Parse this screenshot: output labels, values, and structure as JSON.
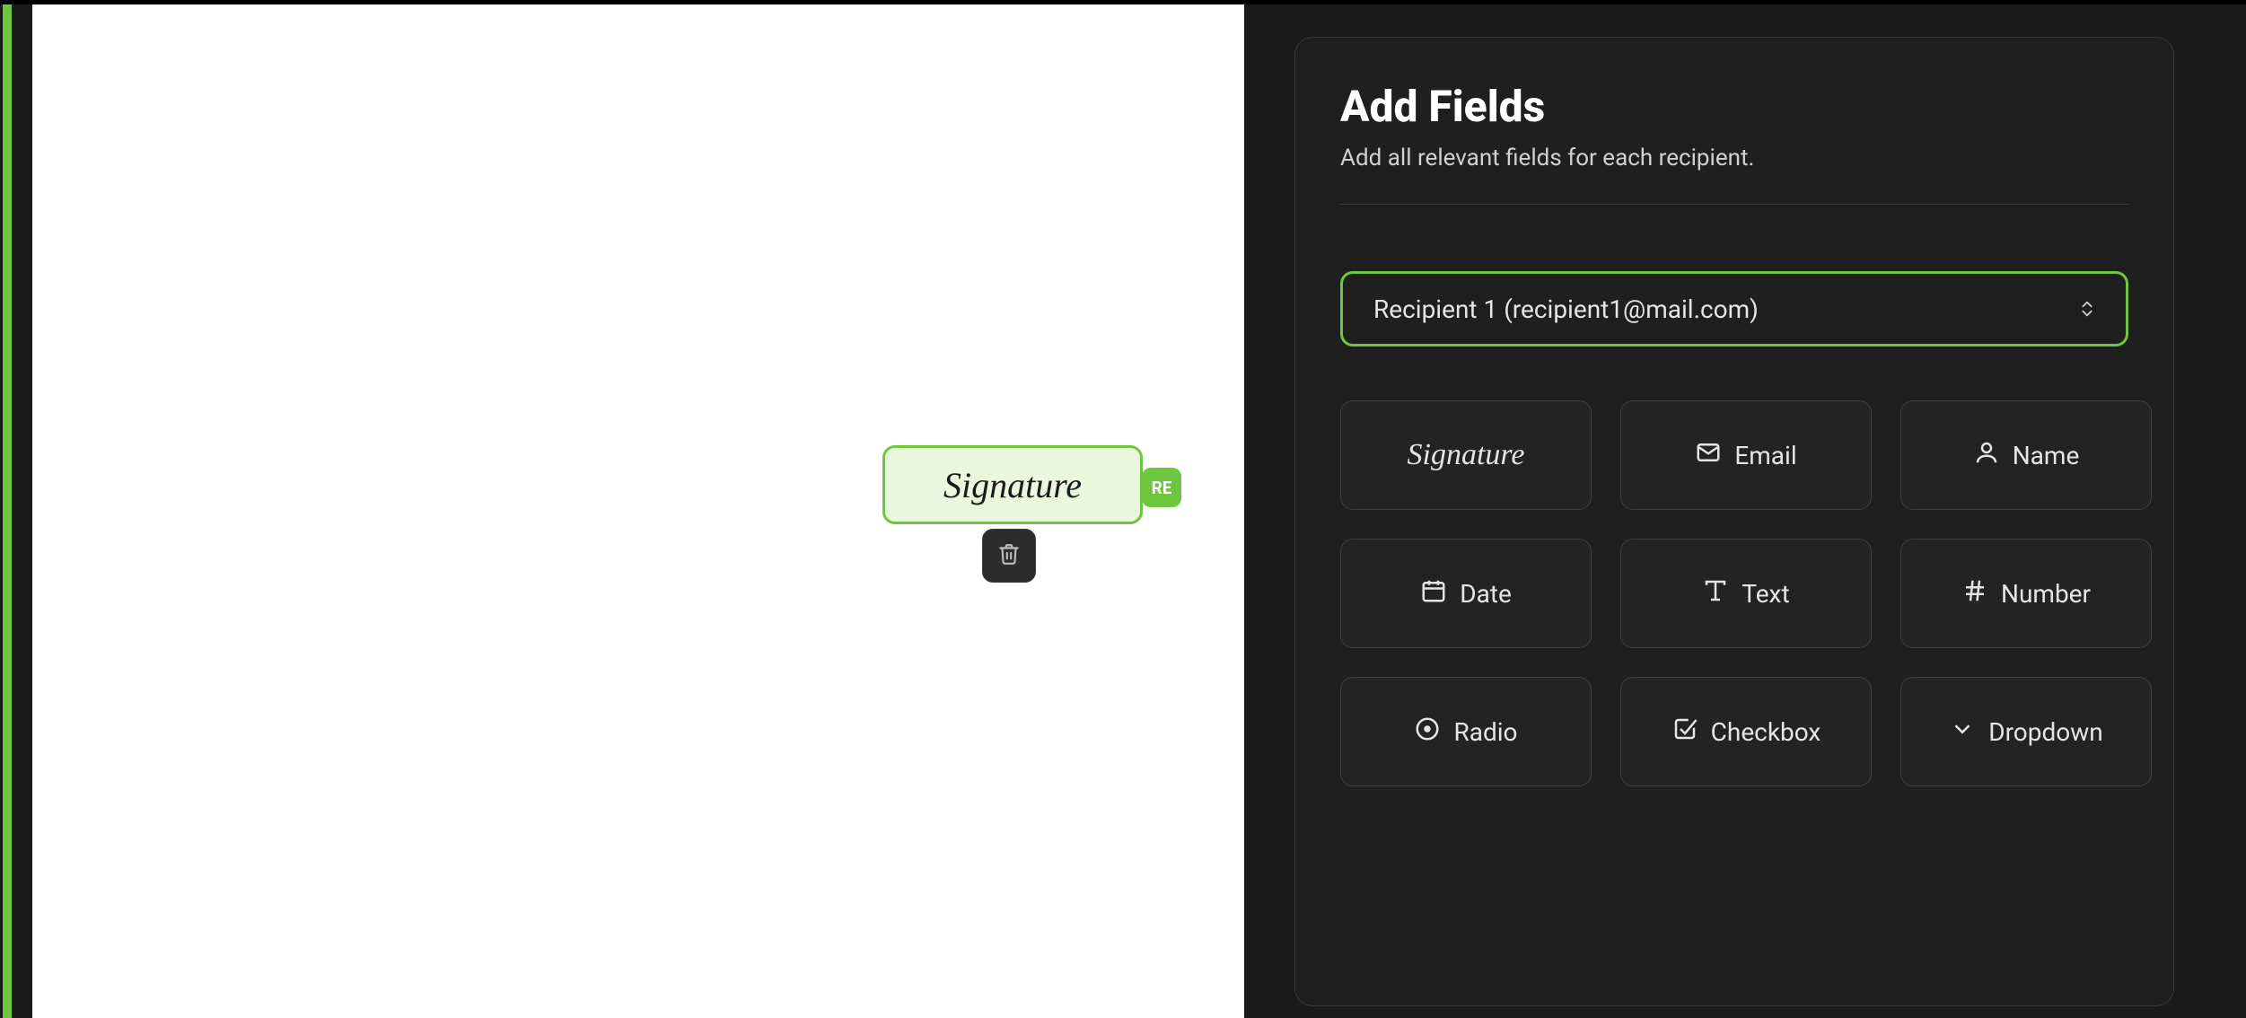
{
  "document": {
    "placed_field": {
      "label": "Signature",
      "recipient_badge": "RE"
    }
  },
  "panel": {
    "title": "Add Fields",
    "subtitle": "Add all relevant fields for each recipient.",
    "recipient_select": {
      "value": "Recipient 1 (recipient1@mail.com)"
    },
    "fields": {
      "signature": "Signature",
      "email": "Email",
      "name": "Name",
      "date": "Date",
      "text": "Text",
      "number": "Number",
      "radio": "Radio",
      "checkbox": "Checkbox",
      "dropdown": "Dropdown"
    }
  },
  "colors": {
    "accent": "#6ec63e"
  }
}
